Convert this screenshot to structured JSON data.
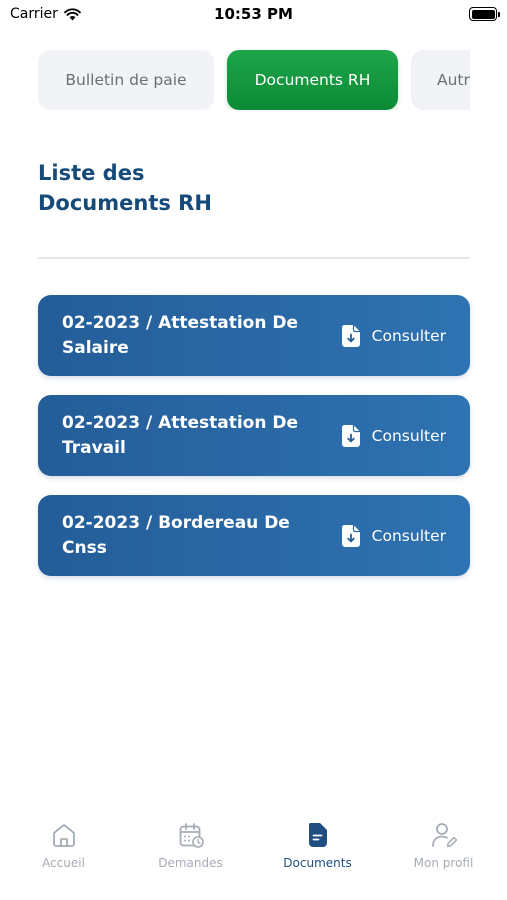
{
  "status_bar": {
    "carrier": "Carrier",
    "time": "10:53 PM"
  },
  "tabs": [
    {
      "label": "Bulletin de paie",
      "active": false
    },
    {
      "label": "Documents RH",
      "active": true
    },
    {
      "label": "Autres",
      "active": false
    }
  ],
  "section": {
    "title_line1": "Liste des",
    "title_line2": "Documents RH"
  },
  "documents": [
    {
      "title": "02-2023 / Attestation De Salaire",
      "action_label": "Consulter"
    },
    {
      "title": "02-2023 / Attestation De Travail",
      "action_label": "Consulter"
    },
    {
      "title": "02-2023 / Bordereau De Cnss",
      "action_label": "Consulter"
    }
  ],
  "bottom_nav": [
    {
      "label": "Accueil",
      "icon": "home-icon",
      "active": false
    },
    {
      "label": "Demandes",
      "icon": "calendar-icon",
      "active": false
    },
    {
      "label": "Documents",
      "icon": "document-icon",
      "active": true
    },
    {
      "label": "Mon profil",
      "icon": "profile-icon",
      "active": false
    }
  ],
  "colors": {
    "accent_green": "#0c8a35",
    "primary_blue": "#245d98",
    "nav_active": "#1f4f80",
    "nav_inactive": "#a6acb6"
  }
}
